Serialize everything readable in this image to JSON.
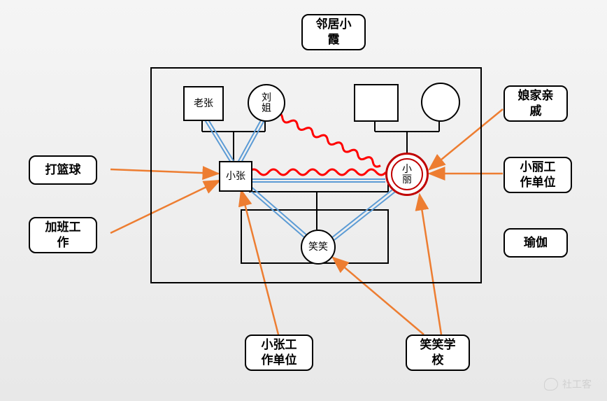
{
  "external": {
    "neighbor": "邻居小\n霞",
    "relatives": "娘家亲\n戚",
    "basketball": "打篮球",
    "overtime": "加班工\n作",
    "yoga": "瑜伽",
    "husband_workplace": "小张工\n作单位",
    "wife_workplace": "小丽工\n作单位",
    "child_school": "笑笑学\n校"
  },
  "family": {
    "grandfather_left": "老张",
    "grandmother_left": "刘\n姐",
    "husband": "小张",
    "wife": "小\n丽",
    "child": "笑笑"
  },
  "watermark": "社工客"
}
